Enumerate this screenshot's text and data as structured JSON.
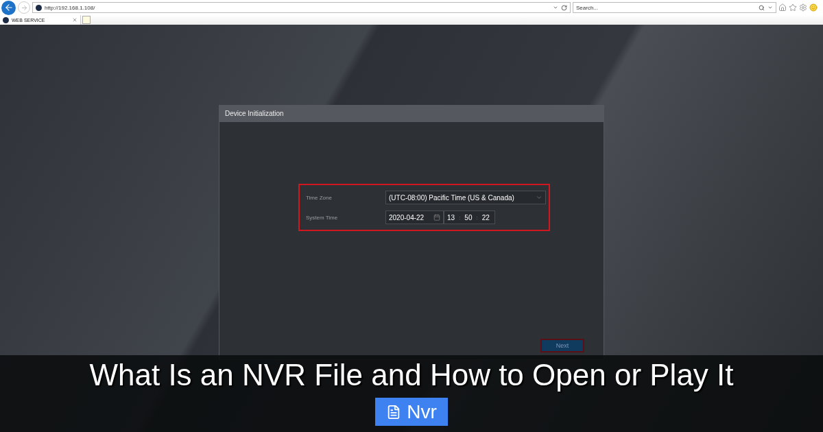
{
  "browser": {
    "address": "http://192.168.1.108/",
    "search_placeholder": "Search...",
    "tabs": [
      {
        "label": "WEB SERVICE",
        "selected": true
      }
    ]
  },
  "dialog": {
    "title": "Device Initialization",
    "fields": [
      {
        "kind": "select",
        "label": "Time Zone",
        "value": "(UTC-08:00) Pacific Time (US & Canada)"
      },
      {
        "kind": "datetime",
        "label": "System Time",
        "date": "2020-04-22",
        "time": [
          "13",
          "50",
          "22"
        ],
        "separator": ":"
      }
    ],
    "buttons": [
      "Next"
    ]
  },
  "overlay": {
    "title": "What Is an NVR File and How to Open or Play It",
    "tag": "Nvr"
  }
}
